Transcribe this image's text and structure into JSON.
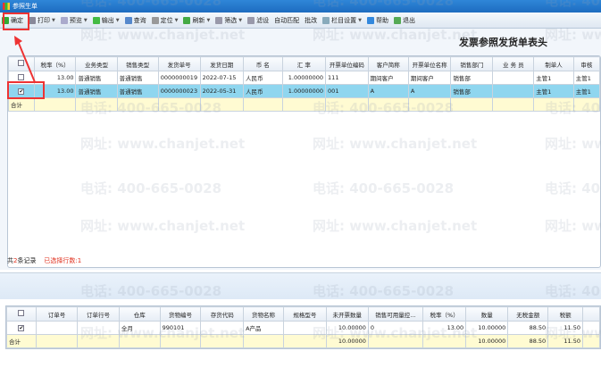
{
  "window": {
    "title": "参照生单"
  },
  "toolbar": [
    {
      "label": "确定",
      "icon": "confirm-icon",
      "color": "#3a3"
    },
    {
      "label": "打印",
      "icon": "print-icon",
      "color": "#889",
      "dd": true
    },
    {
      "label": "预览",
      "icon": "preview-icon",
      "color": "#aac",
      "dd": true
    },
    {
      "label": "输出",
      "icon": "export-icon",
      "color": "#4b4",
      "dd": true
    },
    {
      "label": "查询",
      "icon": "query-icon",
      "color": "#58c"
    },
    {
      "label": "定位",
      "icon": "locate-icon",
      "color": "#999",
      "dd": true
    },
    {
      "label": "刷新",
      "icon": "refresh-icon",
      "color": "#4a4",
      "dd": true
    },
    {
      "label": "筛选",
      "icon": "filter-icon",
      "color": "#99a",
      "dd": true
    },
    {
      "label": "滤设",
      "icon": "filter-settings-icon",
      "color": "#99a"
    },
    {
      "label": "自动匹配",
      "icon": "",
      "color": ""
    },
    {
      "label": "批改",
      "icon": "",
      "color": ""
    },
    {
      "label": "栏目设置",
      "icon": "column-settings-icon",
      "color": "#8ab",
      "dd": true
    },
    {
      "label": "帮助",
      "icon": "help-icon",
      "color": "#38d"
    },
    {
      "label": "退出",
      "icon": "exit-icon",
      "color": "#5a5"
    }
  ],
  "upper": {
    "title": "发票参照发货单表头",
    "columns": [
      "税率（%）",
      "业务类型",
      "销售类型",
      "发货单号",
      "发货日期",
      "币 名",
      "汇 率",
      "开票单位编码",
      "客户简称",
      "开票单位名称",
      "销售部门",
      "业 务 员",
      "制单人",
      "审核"
    ],
    "rows": [
      {
        "checked": false,
        "cells": [
          "13.00",
          "普通销售",
          "普通销售",
          "0000000019",
          "2022-07-15",
          "人民币",
          "1.00000000",
          "111",
          "期间客户",
          "期间客户",
          "销售部",
          "",
          "主管1",
          "主管1"
        ]
      },
      {
        "checked": true,
        "cells": [
          "13.00",
          "普通销售",
          "普通销售",
          "0000000023",
          "2022-05-31",
          "人民币",
          "1.00000000",
          "001",
          "A",
          "A",
          "销售部",
          "",
          "主管1",
          "主管1"
        ]
      }
    ],
    "sum_label": "合计",
    "footer": {
      "prefix": "共",
      "count": "2",
      "suffix": "条记录",
      "selected": "已选择行数:1"
    }
  },
  "lower": {
    "columns": [
      "订单号",
      "订单行号",
      "仓库",
      "货物编号",
      "存货代码",
      "货物名称",
      "规格型号",
      "未开票数量",
      "销售可用量控…",
      "税率（%）",
      "数量",
      "无税金额",
      "税额",
      ""
    ],
    "rows": [
      {
        "checked": true,
        "cells": [
          "",
          "",
          "全月",
          "990101",
          "",
          "A产品",
          "",
          "10.00000",
          "0",
          "13.00",
          "10.00000",
          "88.50",
          "11.50",
          ""
        ]
      }
    ],
    "sum": {
      "label": "合计",
      "cells": [
        "",
        "",
        "",
        "",
        "",
        "",
        "",
        "10.00000",
        "",
        "",
        "10.00000",
        "88.50",
        "11.50",
        ""
      ]
    }
  },
  "watermark": {
    "phone": "电话: 400-665-0028",
    "site": "网址: www.chanjet.net"
  }
}
